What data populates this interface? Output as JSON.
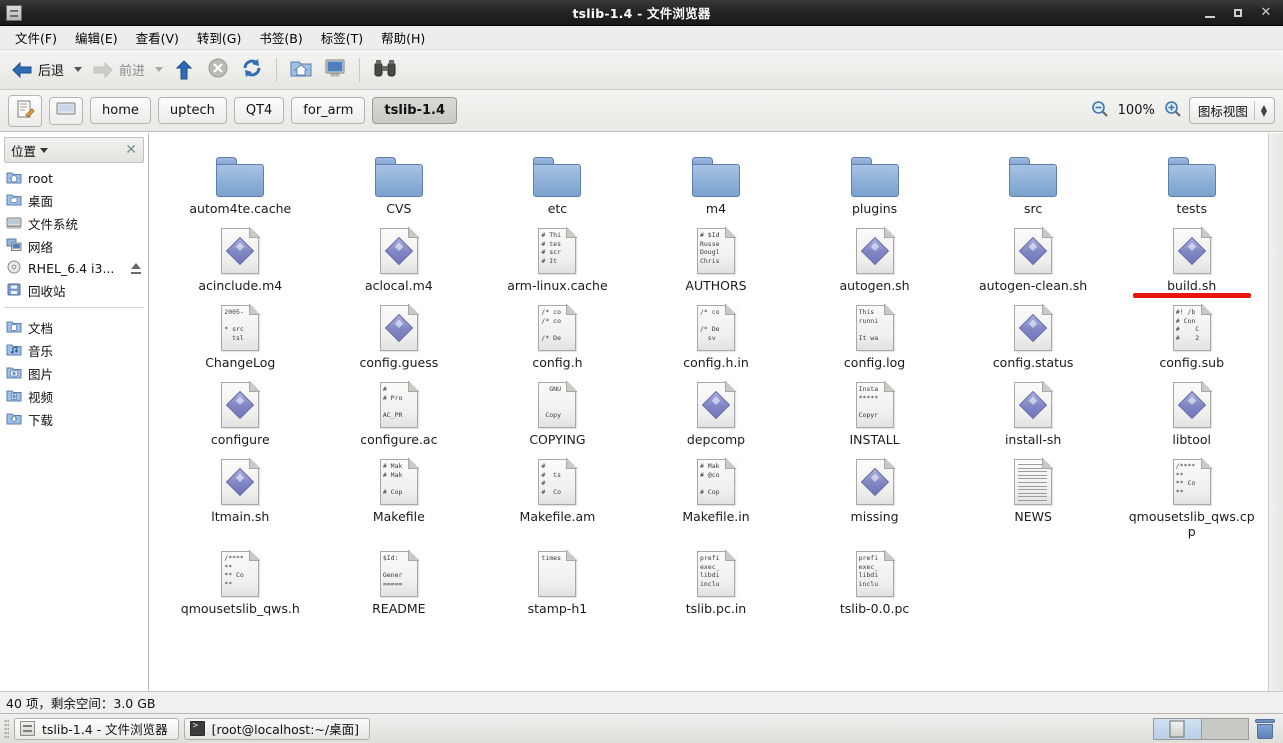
{
  "window": {
    "title": "tslib-1.4 - 文件浏览器",
    "icon": "file-manager-icon",
    "minimize_label": "_",
    "maximize_label": "□",
    "close_label": "✕"
  },
  "menubar": [
    {
      "label": "文件(F)",
      "mnemonic": "F"
    },
    {
      "label": "编辑(E)",
      "mnemonic": "E"
    },
    {
      "label": "查看(V)",
      "mnemonic": "V"
    },
    {
      "label": "转到(G)",
      "mnemonic": "G"
    },
    {
      "label": "书签(B)",
      "mnemonic": "B"
    },
    {
      "label": "标签(T)",
      "mnemonic": "T"
    },
    {
      "label": "帮助(H)",
      "mnemonic": "H"
    }
  ],
  "toolbar": {
    "back_label": "后退",
    "forward_label": "前进",
    "up_icon": "arrow-up-icon",
    "stop_icon": "stop-icon",
    "reload_icon": "reload-icon",
    "home_icon": "home-folder-icon",
    "computer_icon": "computer-icon",
    "search_icon": "binoculars-search-icon"
  },
  "pathbar": {
    "edit_location_icon": "edit-location-icon",
    "computer_icon": "computer-small-icon",
    "crumbs": [
      {
        "label": "home",
        "current": false
      },
      {
        "label": "uptech",
        "current": false
      },
      {
        "label": "QT4",
        "current": false
      },
      {
        "label": "for_arm",
        "current": false
      },
      {
        "label": "tslib-1.4",
        "current": true
      }
    ],
    "zoom_out_icon": "zoom-out-icon",
    "zoom_level": "100%",
    "zoom_in_icon": "zoom-in-icon",
    "view_mode": "图标视图"
  },
  "sidebar": {
    "header_label": "位置",
    "close_label": "✕",
    "groups": [
      {
        "items": [
          {
            "label": "root",
            "icon": "home-folder-icon",
            "eject": false
          },
          {
            "label": "桌面",
            "icon": "desktop-folder-icon",
            "eject": false
          },
          {
            "label": "文件系统",
            "icon": "filesystem-drive-icon",
            "eject": false
          },
          {
            "label": "网络",
            "icon": "network-icon",
            "eject": false
          },
          {
            "label": "RHEL_6.4 i3...",
            "icon": "optical-disc-icon",
            "eject": true
          },
          {
            "label": "回收站",
            "icon": "trash-icon",
            "eject": false
          }
        ]
      },
      {
        "items": [
          {
            "label": "文档",
            "icon": "documents-folder-icon",
            "eject": false
          },
          {
            "label": "音乐",
            "icon": "music-folder-icon",
            "eject": false
          },
          {
            "label": "图片",
            "icon": "pictures-folder-icon",
            "eject": false
          },
          {
            "label": "视频",
            "icon": "videos-folder-icon",
            "eject": false
          },
          {
            "label": "下载",
            "icon": "downloads-folder-icon",
            "eject": false
          }
        ]
      }
    ]
  },
  "files": [
    {
      "name": "autom4te.cache",
      "type": "folder",
      "preview": "",
      "highlight": false
    },
    {
      "name": "CVS",
      "type": "folder",
      "preview": "",
      "highlight": false
    },
    {
      "name": "etc",
      "type": "folder",
      "preview": "",
      "highlight": false
    },
    {
      "name": "m4",
      "type": "folder",
      "preview": "",
      "highlight": false
    },
    {
      "name": "plugins",
      "type": "folder",
      "preview": "",
      "highlight": false
    },
    {
      "name": "src",
      "type": "folder",
      "preview": "",
      "highlight": false
    },
    {
      "name": "tests",
      "type": "folder",
      "preview": "",
      "highlight": false
    },
    {
      "name": "acinclude.m4",
      "type": "script",
      "preview": "",
      "highlight": false
    },
    {
      "name": "aclocal.m4",
      "type": "script",
      "preview": "",
      "highlight": false
    },
    {
      "name": "arm-linux.cache",
      "type": "text",
      "preview": "# Thi\n# tes\n# scr\n# It",
      "highlight": false
    },
    {
      "name": "AUTHORS",
      "type": "text",
      "preview": "# $Id\nRusse\nDougl\nChris",
      "highlight": false
    },
    {
      "name": "autogen.sh",
      "type": "script",
      "preview": "",
      "highlight": false
    },
    {
      "name": "autogen-clean.sh",
      "type": "script",
      "preview": "",
      "highlight": false
    },
    {
      "name": "build.sh",
      "type": "script",
      "preview": "",
      "highlight": true
    },
    {
      "name": "ChangeLog",
      "type": "text",
      "preview": "2005-\n\n* src\n  tsl",
      "highlight": false
    },
    {
      "name": "config.guess",
      "type": "script",
      "preview": "",
      "highlight": false
    },
    {
      "name": "config.h",
      "type": "text",
      "preview": "/* co\n/* co\n\n/* De",
      "highlight": false
    },
    {
      "name": "config.h.in",
      "type": "text",
      "preview": "/* co\n\n/* De\n  sv",
      "highlight": false
    },
    {
      "name": "config.log",
      "type": "text",
      "preview": "This\nrunni\n\nIt wa",
      "highlight": false
    },
    {
      "name": "config.status",
      "type": "script",
      "preview": "",
      "highlight": false
    },
    {
      "name": "config.sub",
      "type": "text",
      "preview": "#! /b\n# Con\n#    C\n#    2",
      "highlight": false
    },
    {
      "name": "configure",
      "type": "script",
      "preview": "",
      "highlight": false
    },
    {
      "name": "configure.ac",
      "type": "text",
      "preview": "#\n# Pro\n\nAC_PR",
      "highlight": false
    },
    {
      "name": "COPYING",
      "type": "text",
      "preview": "  GNU\n\n\n Copy",
      "highlight": false
    },
    {
      "name": "depcomp",
      "type": "script",
      "preview": "",
      "highlight": false
    },
    {
      "name": "INSTALL",
      "type": "text",
      "preview": "Insta\n*****\n\nCopyr",
      "highlight": false
    },
    {
      "name": "install-sh",
      "type": "script",
      "preview": "",
      "highlight": false
    },
    {
      "name": "libtool",
      "type": "script",
      "preview": "",
      "highlight": false
    },
    {
      "name": "ltmain.sh",
      "type": "script",
      "preview": "",
      "highlight": false
    },
    {
      "name": "Makefile",
      "type": "text",
      "preview": "# Mak\n# Mak\n\n# Cop",
      "highlight": false
    },
    {
      "name": "Makefile.am",
      "type": "text",
      "preview": "#\n#  ts\n#\n#  Co",
      "highlight": false
    },
    {
      "name": "Makefile.in",
      "type": "text",
      "preview": "# Mak\n# @co\n\n# Cop",
      "highlight": false
    },
    {
      "name": "missing",
      "type": "script",
      "preview": "",
      "highlight": false
    },
    {
      "name": "NEWS",
      "type": "lined",
      "preview": "",
      "highlight": false
    },
    {
      "name": "qmousetslib_qws.cpp",
      "type": "text",
      "preview": "/****\n**\n** Co\n**",
      "highlight": false
    },
    {
      "name": "qmousetslib_qws.h",
      "type": "text",
      "preview": "/****\n**\n** Co\n**",
      "highlight": false
    },
    {
      "name": "README",
      "type": "text",
      "preview": "$Id:\n\nGener\n=====",
      "highlight": false
    },
    {
      "name": "stamp-h1",
      "type": "text",
      "preview": "times",
      "highlight": false
    },
    {
      "name": "tslib.pc.in",
      "type": "text",
      "preview": "prefi\nexec_\nlibdi\ninclu",
      "highlight": false
    },
    {
      "name": "tslib-0.0.pc",
      "type": "text",
      "preview": "prefi\nexec_\nlibdi\ninclu",
      "highlight": false
    }
  ],
  "statusbar": {
    "text": "40 项，剩余空间：3.0 GB"
  },
  "taskbar": {
    "buttons": [
      {
        "label": "tslib-1.4 - 文件浏览器",
        "icon": "file-manager-icon",
        "active": true
      },
      {
        "label": "[root@localhost:~/桌面]",
        "icon": "terminal-icon",
        "active": false
      }
    ],
    "workspace_count": 2,
    "active_workspace": 1,
    "trash_icon": "trash-icon"
  },
  "colors": {
    "titlebar": "#242424",
    "accent_red": "#e8140f",
    "folder_blue": "#8db0d8",
    "panel_bg": "#ededeb"
  }
}
